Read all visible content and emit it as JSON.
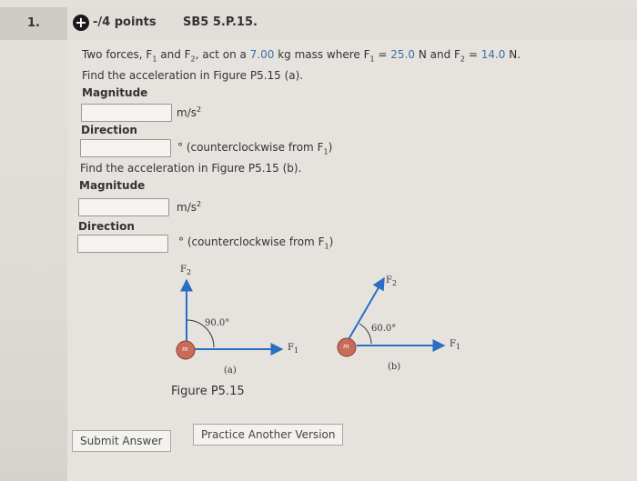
{
  "question": {
    "number": "1.",
    "points": "-/4 points",
    "code": "SB5 5.P.15."
  },
  "problem": {
    "prefix": "Two forces, F",
    "sub1": "1",
    "and": " and F",
    "sub2": "2",
    "mid": ", act on a ",
    "mass_value": "7.00",
    "mass_unit": " kg mass where F",
    "eq_sub1": "1",
    "eq1": " = ",
    "f1_value": "25.0",
    "f1_unit": " N and F",
    "eq_sub2": "2",
    "eq2": " = ",
    "f2_value": "14.0",
    "f2_unit": " N."
  },
  "part_a": {
    "prompt": "Find the acceleration in Figure P5.15 (a).",
    "magnitude_label": "Magnitude",
    "magnitude_value": "",
    "magnitude_unit": "m/s",
    "magnitude_unit_sup": "2",
    "direction_label": "Direction",
    "direction_value": "",
    "direction_unit": "° (counterclockwise from F",
    "direction_unit_sub": "1",
    "direction_unit_end": ")"
  },
  "part_b": {
    "prompt": "Find the acceleration in Figure P5.15 (b).",
    "magnitude_label": "Magnitude",
    "magnitude_value": "",
    "magnitude_unit": "m/s",
    "magnitude_unit_sup": "2",
    "direction_label": "Direction",
    "direction_value": "",
    "direction_unit": "° (counterclockwise from F",
    "direction_unit_sub": "1",
    "direction_unit_end": ")"
  },
  "figure": {
    "caption": "Figure P5.15",
    "a": {
      "f2_label": "F",
      "f2_sub": "2",
      "f1_label": "F",
      "f1_sub": "1",
      "angle": "90.0°",
      "mass": "m",
      "label": "(a)"
    },
    "b": {
      "f2_label": "F",
      "f2_sub": "2",
      "f1_label": "F",
      "f1_sub": "1",
      "angle": "60.0°",
      "mass": "m",
      "label": "(b)"
    },
    "arrow_color": "#2a6fc4",
    "mass_color": "#c96b5a"
  },
  "buttons": {
    "submit": "Submit Answer",
    "practice": "Practice Another Version"
  }
}
